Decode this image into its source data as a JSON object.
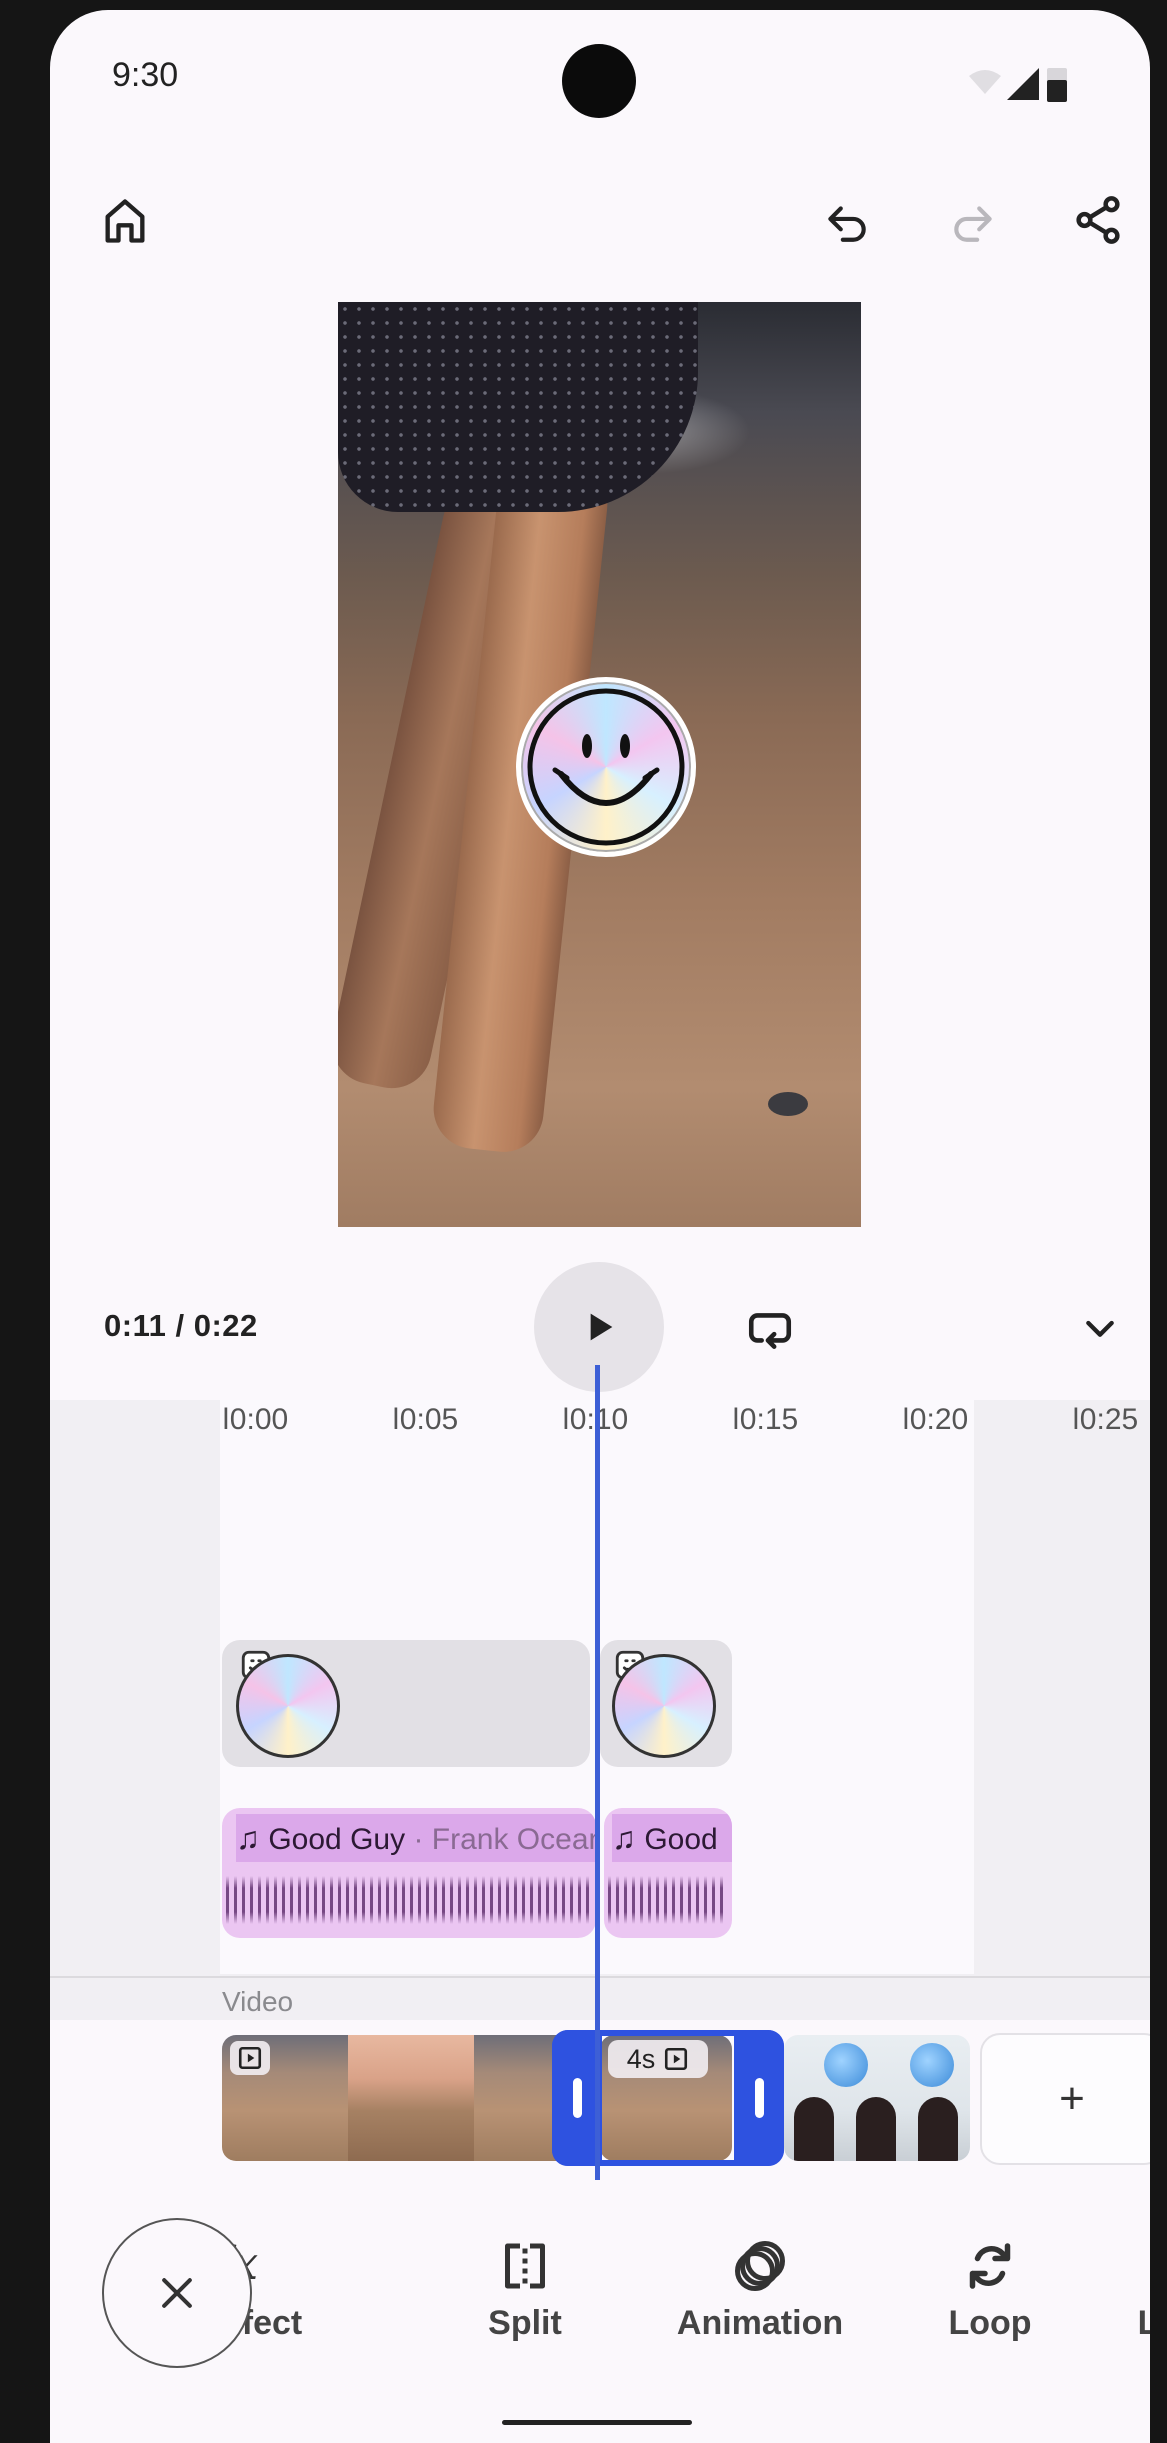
{
  "status_bar": {
    "time": "9:30"
  },
  "toolbar": {
    "home": "home-icon",
    "undo": "undo-icon",
    "redo": "redo-icon",
    "share": "share-icon"
  },
  "playback": {
    "current_time": "0:11",
    "separator": "/",
    "total_time": "0:22"
  },
  "ruler": {
    "labels": [
      "0:00",
      "0:05",
      "0:10",
      "0:15",
      "0:20",
      "0:25"
    ]
  },
  "audio": {
    "song": "Good Guy",
    "separator": "·",
    "artist": "Frank Ocean",
    "song_short": "Good"
  },
  "video_track": {
    "label": "Video",
    "selected_clip_duration": "4s",
    "add_label": "+"
  },
  "tools": [
    {
      "label": "Effect",
      "icon": "fx-icon"
    },
    {
      "label": "Split",
      "icon": "split-icon"
    },
    {
      "label": "Animation",
      "icon": "animation-icon"
    },
    {
      "label": "Loop",
      "icon": "loop-icon"
    },
    {
      "label": "L",
      "icon": "more-tool"
    }
  ],
  "colors": {
    "accent": "#2e52e0",
    "playhead": "#3d5fd6",
    "audio": "#ebc6f2"
  }
}
